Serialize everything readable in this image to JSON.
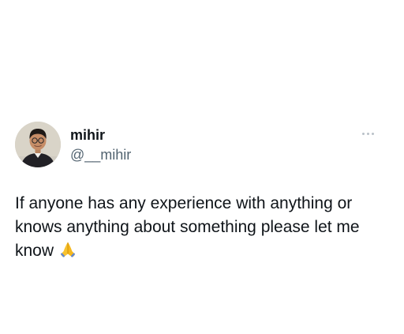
{
  "author": {
    "display_name": "mihir",
    "handle": "@__mihir",
    "avatar_icon": "profile-photo"
  },
  "tweet": {
    "text": "If anyone has any experience with anything or knows anything about something please let me know",
    "emoji_icon": "folded-hands-emoji"
  },
  "menu": {
    "icon": "more-options-icon"
  },
  "colors": {
    "text_primary": "#0f1419",
    "text_secondary": "#536471",
    "menu_dots": "#b9c1c8",
    "background": "#ffffff"
  }
}
